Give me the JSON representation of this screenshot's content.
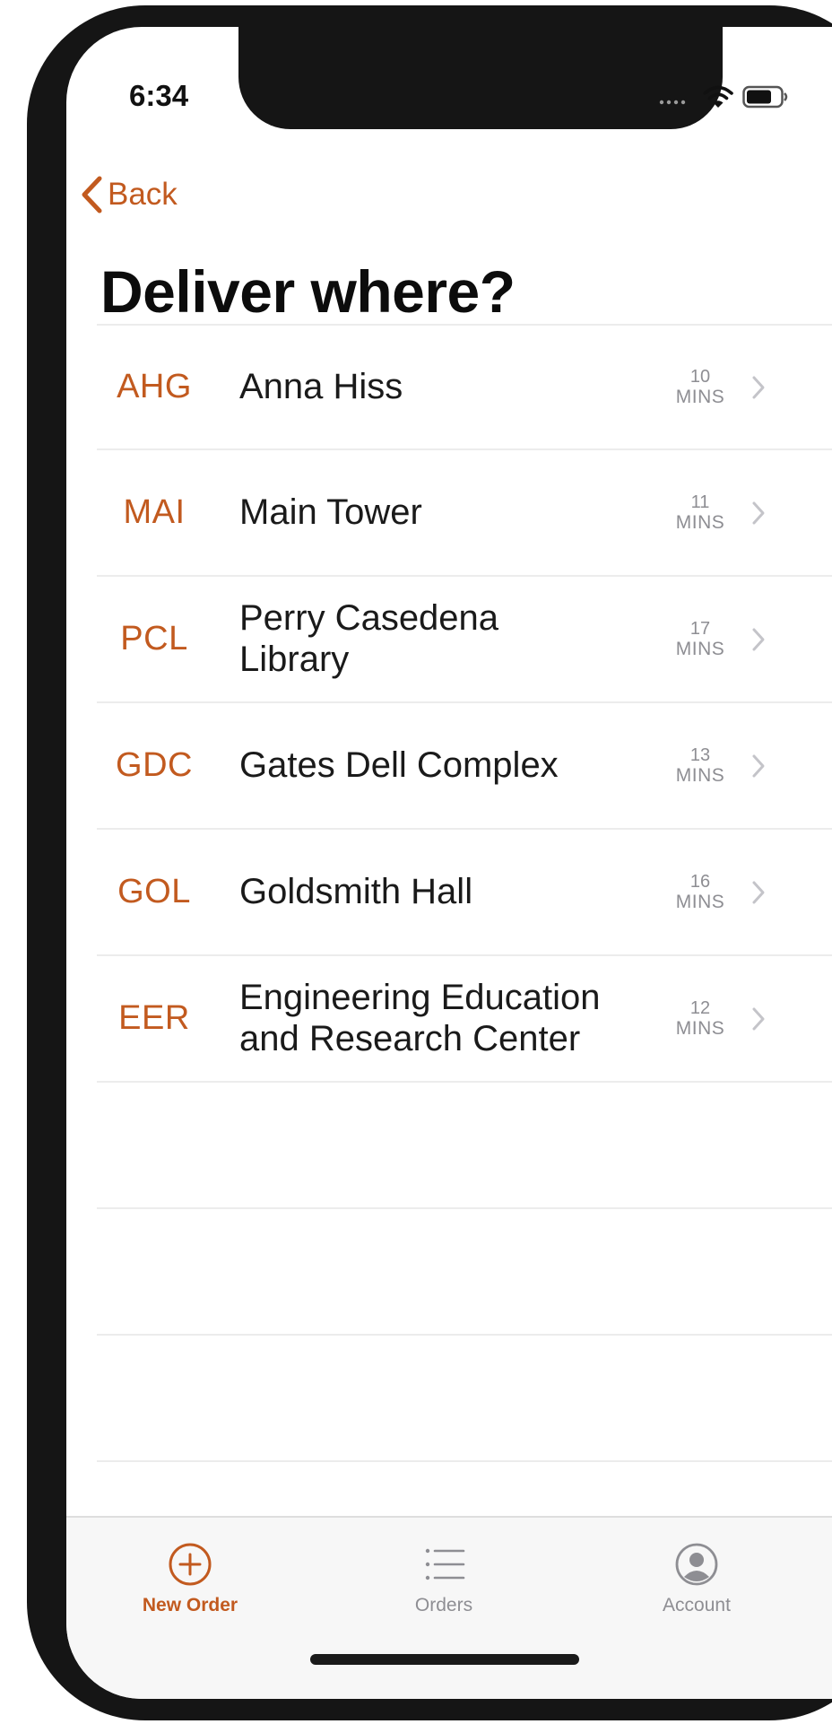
{
  "status_bar": {
    "time": "6:34",
    "icons": [
      "signal-icon",
      "wifi-icon",
      "battery-icon"
    ]
  },
  "nav": {
    "back_label": "Back"
  },
  "page": {
    "title": "Deliver where?"
  },
  "locations": [
    {
      "code": "AHG",
      "name": "Anna Hiss",
      "minutes": "10",
      "unit": "MINS"
    },
    {
      "code": "MAI",
      "name": "Main Tower",
      "minutes": "11",
      "unit": "MINS"
    },
    {
      "code": "PCL",
      "name": "Perry Casedena Library",
      "minutes": "17",
      "unit": "MINS"
    },
    {
      "code": "GDC",
      "name": "Gates Dell Complex",
      "minutes": "13",
      "unit": "MINS"
    },
    {
      "code": "GOL",
      "name": "Goldsmith Hall",
      "minutes": "16",
      "unit": "MINS"
    },
    {
      "code": "EER",
      "name": "Engineering Education and Research Center",
      "minutes": "12",
      "unit": "MINS"
    }
  ],
  "tabs": [
    {
      "label": "New Order",
      "icon": "plus-circle-icon",
      "active": true
    },
    {
      "label": "Orders",
      "icon": "list-icon",
      "active": false
    },
    {
      "label": "Account",
      "icon": "person-circle-icon",
      "active": false
    }
  ],
  "colors": {
    "accent": "#c25a1f",
    "secondary_text": "#8e8e93",
    "frame": "#151515"
  }
}
